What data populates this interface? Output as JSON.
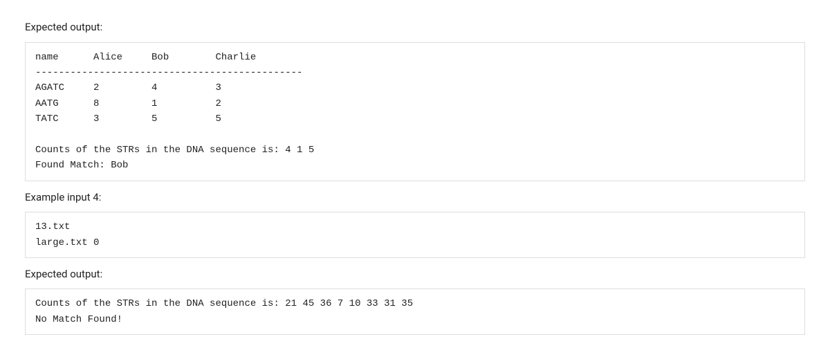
{
  "labels": {
    "expected_output_1": "Expected output:",
    "example_input_4": "Example input 4:",
    "expected_output_2": "Expected output:"
  },
  "block1": {
    "text": "name      Alice     Bob        Charlie\n----------------------------------------------\nAGATC     2         4          3\nAATG      8         1          2\nTATC      3         5          5\n\nCounts of the STRs in the DNA sequence is: 4 1 5\nFound Match: Bob"
  },
  "block2": {
    "text": "13.txt\nlarge.txt 0"
  },
  "block3": {
    "text": "Counts of the STRs in the DNA sequence is: 21 45 36 7 10 33 31 35\nNo Match Found!"
  },
  "structured": {
    "output1": {
      "header": [
        "name",
        "Alice",
        "Bob",
        "Charlie"
      ],
      "rows": [
        {
          "str": "AGATC",
          "Alice": 2,
          "Bob": 4,
          "Charlie": 3
        },
        {
          "str": "AATG",
          "Alice": 8,
          "Bob": 1,
          "Charlie": 2
        },
        {
          "str": "TATC",
          "Alice": 3,
          "Bob": 5,
          "Charlie": 5
        }
      ],
      "counts_line": "Counts of the STRs in the DNA sequence is: 4 1 5",
      "counts": [
        4,
        1,
        5
      ],
      "match_line": "Found Match: Bob",
      "match": "Bob"
    },
    "input4": {
      "lines": [
        "13.txt",
        "large.txt 0"
      ]
    },
    "output2": {
      "counts_line": "Counts of the STRs in the DNA sequence is: 21 45 36 7 10 33 31 35",
      "counts": [
        21,
        45,
        36,
        7,
        10,
        33,
        31,
        35
      ],
      "match_line": "No Match Found!"
    }
  }
}
